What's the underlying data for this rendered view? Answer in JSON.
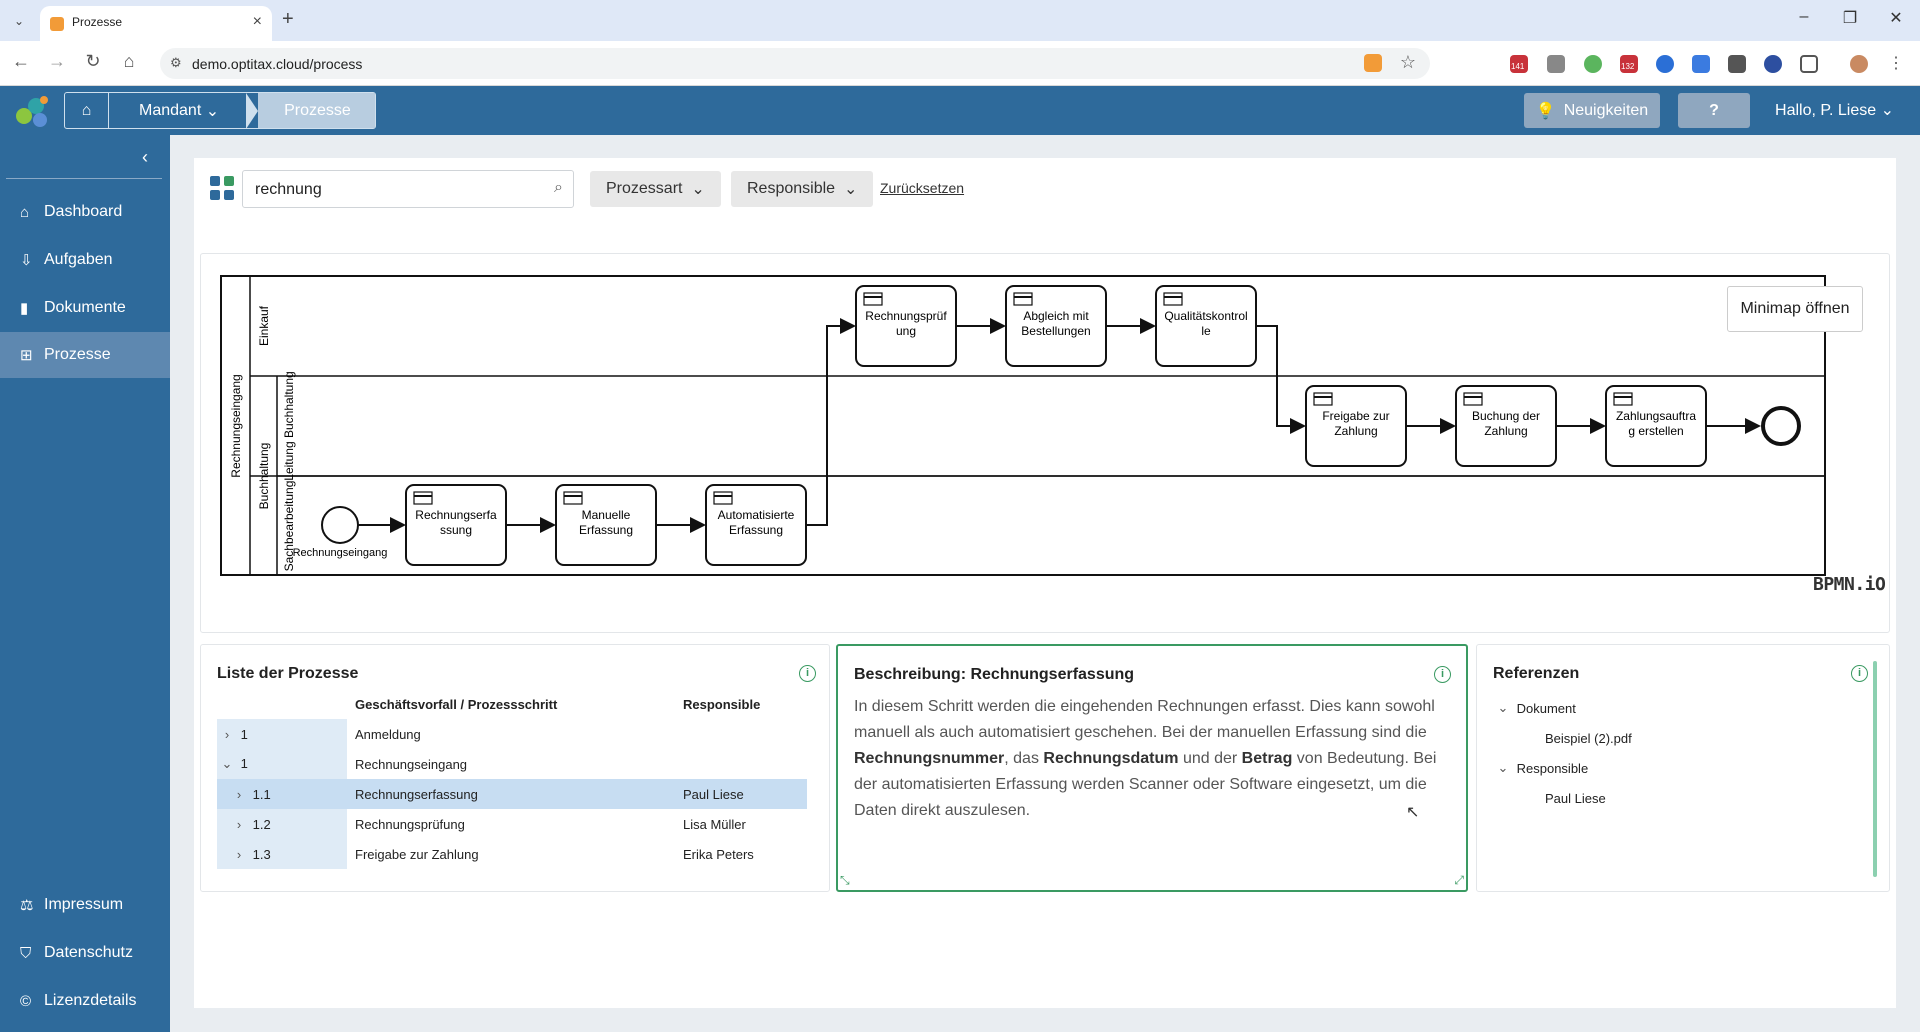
{
  "browser": {
    "tab_title": "Prozesse",
    "url": "demo.optitax.cloud/process",
    "badges": {
      "cal1": "141",
      "cal2": "132"
    }
  },
  "header": {
    "breadcrumb": {
      "mandant": "Mandant",
      "current": "Prozesse"
    },
    "news_label": "Neuigkeiten",
    "help_label": "?",
    "greeting": "Hallo, P. Liese"
  },
  "sidebar": {
    "items": [
      {
        "label": "Dashboard"
      },
      {
        "label": "Aufgaben"
      },
      {
        "label": "Dokumente"
      },
      {
        "label": "Prozesse"
      }
    ],
    "footer": [
      {
        "label": "Impressum"
      },
      {
        "label": "Datenschutz"
      },
      {
        "label": "Lizenzdetails"
      }
    ]
  },
  "toolbar": {
    "search_value": "rechnung",
    "filter_type": "Prozessart",
    "filter_responsible": "Responsible",
    "reset": "Zurücksetzen"
  },
  "diagram": {
    "minimap": "Minimap öffnen",
    "watermark": "BPMN.iO",
    "pool": "Rechnungseingang",
    "lanes": {
      "einkauf": "Einkauf",
      "buchhaltung": "Buchhaltung",
      "leitung": "Leitung Buchhaltung",
      "sach": "Sachbearbeitung"
    },
    "start_label": "Rechnungseingang",
    "tasks": {
      "t1": [
        "Rechnungserfa",
        "ssung"
      ],
      "t2": [
        "Manuelle",
        "Erfassung"
      ],
      "t3": [
        "Automatisierte",
        "Erfassung"
      ],
      "t4": [
        "Rechnungsprüf",
        "ung"
      ],
      "t5": [
        "Abgleich mit",
        "Bestellungen"
      ],
      "t6": [
        "Qualitätskontrol",
        "le"
      ],
      "t7": [
        "Freigabe zur",
        "Zahlung"
      ],
      "t8": [
        "Buchung der",
        "Zahlung"
      ],
      "t9": [
        "Zahlungsauftra",
        "g erstellen"
      ]
    }
  },
  "processes": {
    "title": "Liste der Prozesse",
    "columns": {
      "step": "Geschäftsvorfall / Prozessschritt",
      "responsible": "Responsible"
    },
    "rows": [
      {
        "num": "1",
        "name": "Anmeldung",
        "resp": "",
        "chev": "›",
        "indent": 0
      },
      {
        "num": "1",
        "name": "Rechnungseingang",
        "resp": "",
        "chev": "⌄",
        "indent": 0
      },
      {
        "num": "1.1",
        "name": "Rechnungserfassung",
        "resp": "Paul Liese",
        "chev": "›",
        "indent": 1,
        "selected": true
      },
      {
        "num": "1.2",
        "name": "Rechnungsprüfung",
        "resp": "Lisa Müller",
        "chev": "›",
        "indent": 1
      },
      {
        "num": "1.3",
        "name": "Freigabe zur Zahlung",
        "resp": "Erika Peters",
        "chev": "›",
        "indent": 1
      }
    ]
  },
  "description": {
    "title": "Beschreibung: Rechnungserfassung",
    "p1": "In diesem Schritt werden die eingehenden Rechnungen erfasst. Dies kann sowohl manuell als auch automatisiert geschehen. Bei der manuellen Erfassung sind die ",
    "b1": "Rechnungsnummer",
    "p2": ", das ",
    "b2": "Rechnungsdatum",
    "p3": " und der ",
    "b3": "Betrag",
    "p4": " von Bedeutung. Bei der automatisierten Erfassung werden Scanner oder Software eingesetzt, um die Daten direkt auszulesen."
  },
  "references": {
    "title": "Referenzen",
    "doc_group": "Dokument",
    "doc_item": "Beispiel (2).pdf",
    "resp_group": "Responsible",
    "resp_item": "Paul Liese"
  },
  "colors": {
    "brand": "#2e6a9b",
    "accent": "#3a9a62"
  }
}
